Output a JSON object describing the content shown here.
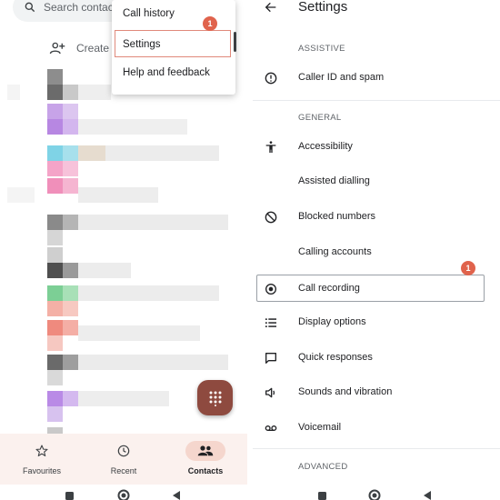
{
  "left": {
    "search_placeholder": "Search contact",
    "create_label": "Create",
    "menu": {
      "items": [
        "Call history",
        "Settings",
        "Help and feedback"
      ],
      "badge": "1"
    },
    "bottom_nav": [
      "Favourites",
      "Recent",
      "Contacts"
    ]
  },
  "right": {
    "title": "Settings",
    "sections": {
      "assistive": "ASSISTIVE",
      "general": "GENERAL",
      "advanced": "ADVANCED"
    },
    "items": {
      "caller_id": "Caller ID and spam",
      "accessibility": "Accessibility",
      "assisted_dialling": "Assisted dialling",
      "blocked_numbers": "Blocked numbers",
      "calling_accounts": "Calling accounts",
      "call_recording": "Call recording",
      "display_options": "Display options",
      "quick_responses": "Quick responses",
      "sounds_vibration": "Sounds and vibration",
      "voicemail": "Voicemail"
    },
    "badge": "1"
  }
}
